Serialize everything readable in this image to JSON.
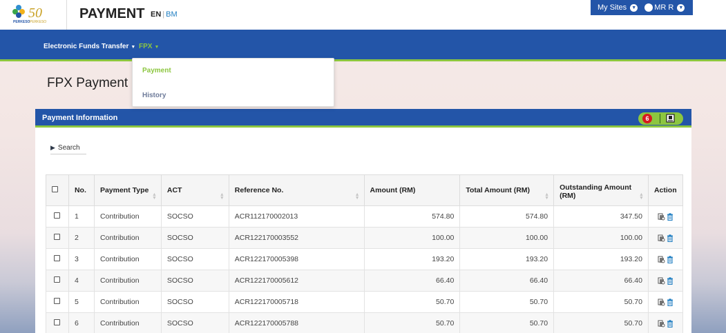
{
  "header": {
    "logo_alt": "PERKESO 50",
    "title": "PAYMENT",
    "lang_en": "EN",
    "lang_sep": "|",
    "lang_bm": "BM",
    "my_sites": "My Sites",
    "user": "MR R"
  },
  "nav": {
    "items": [
      {
        "label": "Electronic Funds Transfer"
      },
      {
        "label": "FPX"
      }
    ],
    "dropdown": [
      {
        "label": "Payment"
      },
      {
        "label": "History"
      }
    ]
  },
  "page": {
    "title": "FPX Payment"
  },
  "panel": {
    "title": "Payment Information",
    "badge_count": "6",
    "search_label": "Search"
  },
  "table": {
    "columns": [
      "No.",
      "Payment Type",
      "ACT",
      "Reference No.",
      "Amount (RM)",
      "Total Amount (RM)",
      "Outstanding Amount (RM)",
      "Action"
    ],
    "rows": [
      {
        "no": "1",
        "type": "Contribution",
        "act": "SOCSO",
        "ref": "ACR112170002013",
        "amount": "574.80",
        "total": "574.80",
        "outstanding": "347.50"
      },
      {
        "no": "2",
        "type": "Contribution",
        "act": "SOCSO",
        "ref": "ACR122170003552",
        "amount": "100.00",
        "total": "100.00",
        "outstanding": "100.00"
      },
      {
        "no": "3",
        "type": "Contribution",
        "act": "SOCSO",
        "ref": "ACR122170005398",
        "amount": "193.20",
        "total": "193.20",
        "outstanding": "193.20"
      },
      {
        "no": "4",
        "type": "Contribution",
        "act": "SOCSO",
        "ref": "ACR122170005612",
        "amount": "66.40",
        "total": "66.40",
        "outstanding": "66.40"
      },
      {
        "no": "5",
        "type": "Contribution",
        "act": "SOCSO",
        "ref": "ACR122170005718",
        "amount": "50.70",
        "total": "50.70",
        "outstanding": "50.70"
      },
      {
        "no": "6",
        "type": "Contribution",
        "act": "SOCSO",
        "ref": "ACR122170005788",
        "amount": "50.70",
        "total": "50.70",
        "outstanding": "50.70"
      }
    ]
  },
  "colors": {
    "brand_blue": "#2355a8",
    "accent_green": "#8cc63f",
    "badge_red": "#d71920"
  },
  "icons": {
    "row_actions": [
      "view-document-icon",
      "delete-icon"
    ],
    "panel_tool": "export-icon"
  }
}
